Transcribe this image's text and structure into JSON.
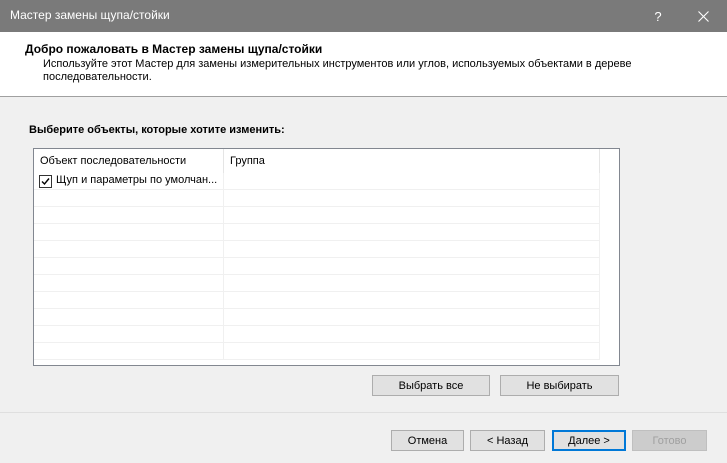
{
  "window": {
    "title": "Мастер замены щупа/стойки",
    "help_label": "?",
    "icons": {
      "close": "close-icon",
      "checkbox": "checkmark-icon"
    }
  },
  "header": {
    "title": "Добро пожаловать в Мастер замены щупа/стойки",
    "description": "Используйте этот Мастер для замены измерительных инструментов или углов, используемых объектами в дереве последовательности."
  },
  "prompt": "Выберите объекты, которые хотите изменить:",
  "list": {
    "columns": [
      "Объект последовательности",
      "Группа"
    ],
    "items": [
      {
        "label": "Щуп и параметры по умолчан...",
        "group": "",
        "checked": true
      }
    ]
  },
  "selection_buttons": {
    "select_all": "Выбрать все",
    "select_none": "Не выбирать"
  },
  "footer": {
    "cancel": "Отмена",
    "back": "< Назад",
    "next": "Далее >",
    "finish": "Готово"
  }
}
